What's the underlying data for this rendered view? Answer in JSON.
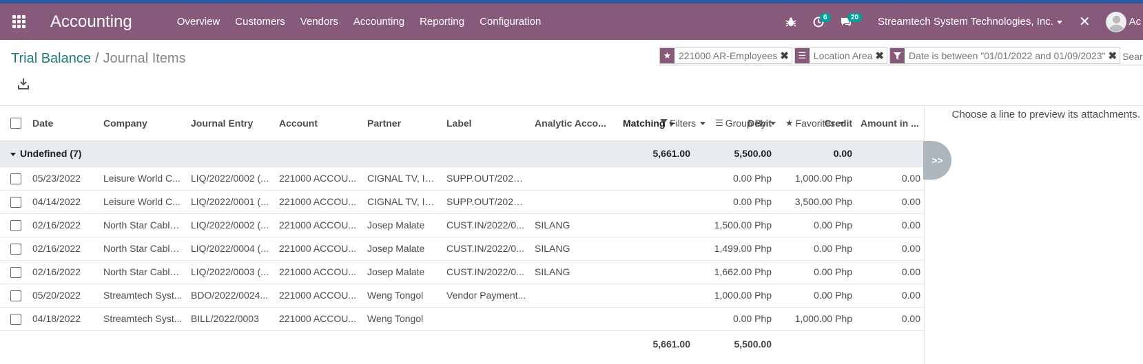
{
  "navbar": {
    "brand": "Accounting",
    "menu": [
      "Overview",
      "Customers",
      "Vendors",
      "Accounting",
      "Reporting",
      "Configuration"
    ],
    "activity_count": "6",
    "message_count": "20",
    "company": "Streamtech System Technologies, Inc.",
    "user_initials": "Ac"
  },
  "breadcrumb": {
    "parent": "Trial Balance",
    "separator": "/",
    "current": "Journal Items"
  },
  "search": {
    "facets": [
      {
        "icon": "star-icon",
        "value": "221000 AR-Employees"
      },
      {
        "icon": "list-icon",
        "value": "Location Area"
      },
      {
        "icon": "filter-icon",
        "value": "Date is between \"01/01/2022 and 01/09/2023\""
      }
    ],
    "placeholder": "Search..."
  },
  "search_options": {
    "filters": "Filters",
    "group_by": "Group By",
    "favorites": "Favorites"
  },
  "table": {
    "columns": [
      "Date",
      "Company",
      "Journal Entry",
      "Account",
      "Partner",
      "Label",
      "Analytic Acco...",
      "Matching",
      "Debit",
      "Credit",
      "Amount in ..."
    ],
    "group": {
      "label": "Undefined (7)",
      "debit": "5,661.00",
      "credit": "5,500.00",
      "amount": "0.00"
    },
    "rows": [
      [
        "05/23/2022",
        "Leisure World C...",
        "LIQ/2022/0002 (...",
        "221000 ACCOU...",
        "CIGNAL TV, INC.",
        "SUPP.OUT/2022...",
        "",
        "",
        "0.00 Php",
        "1,000.00 Php",
        "0.00"
      ],
      [
        "04/14/2022",
        "Leisure World C...",
        "LIQ/2022/0001 (...",
        "221000 ACCOU...",
        "CIGNAL TV, INC.",
        "SUPP.OUT/2022...",
        "",
        "",
        "0.00 Php",
        "3,500.00 Php",
        "0.00"
      ],
      [
        "02/16/2022",
        "North Star Cable...",
        "LIQ/2022/0002 (...",
        "221000 ACCOU...",
        "Josep Malate",
        "CUST.IN/2022/0...",
        "SILANG",
        "",
        "1,500.00 Php",
        "0.00 Php",
        "0.00"
      ],
      [
        "02/16/2022",
        "North Star Cable...",
        "LIQ/2022/0004 (...",
        "221000 ACCOU...",
        "Josep Malate",
        "CUST.IN/2022/0...",
        "SILANG",
        "",
        "1,499.00 Php",
        "0.00 Php",
        "0.00"
      ],
      [
        "02/16/2022",
        "North Star Cable...",
        "LIQ/2022/0003 (...",
        "221000 ACCOU...",
        "Josep Malate",
        "CUST.IN/2022/0...",
        "SILANG",
        "",
        "1,662.00 Php",
        "0.00 Php",
        "0.00"
      ],
      [
        "05/20/2022",
        "Streamtech Syst...",
        "BDO/2022/0024...",
        "221000 ACCOU...",
        "Weng Tongol",
        "Vendor Payment...",
        "",
        "",
        "1,000.00 Php",
        "0.00 Php",
        "0.00"
      ],
      [
        "04/18/2022",
        "Streamtech Syst...",
        "BILL/2022/0003",
        "221000 ACCOU...",
        "Weng Tongol",
        "",
        "",
        "",
        "0.00 Php",
        "1,000.00 Php",
        "0.00"
      ]
    ],
    "totals": {
      "debit": "5,661.00",
      "credit": "5,500.00"
    }
  },
  "preview": {
    "text": "Choose a line to preview its attachments.",
    "toggle": ">>"
  },
  "colors": {
    "navbar": "#875a7b",
    "accent": "#1f7a77",
    "badge": "#00a09d"
  }
}
